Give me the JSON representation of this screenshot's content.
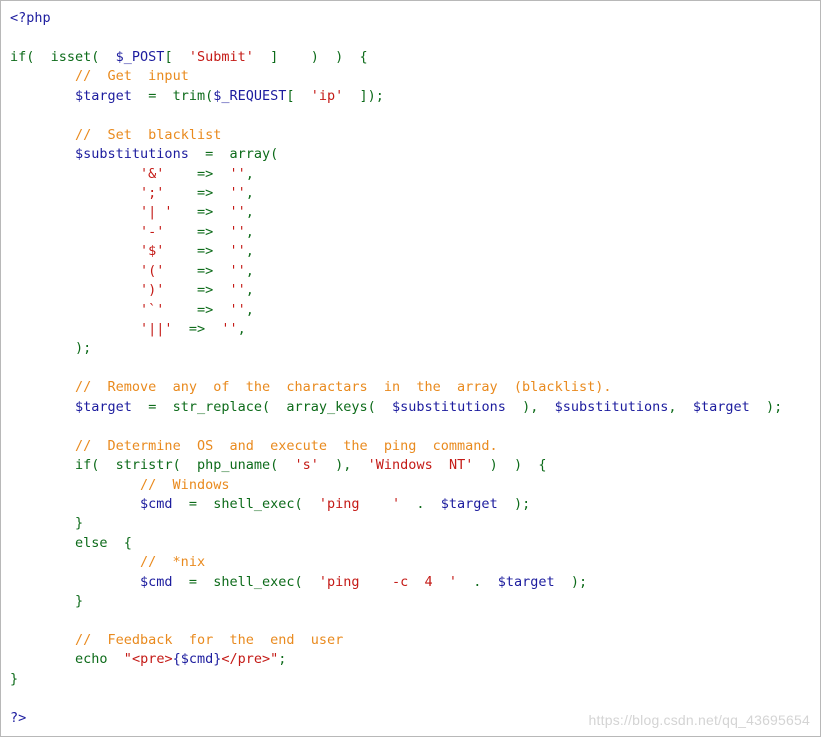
{
  "colors": {
    "keyword": "#0d6b1a",
    "variable": "#1c1c9e",
    "string": "#c41a16",
    "comment": "#e98a1e",
    "background": "#ffffff",
    "watermark": "#d4d4d4"
  },
  "code_lines": [
    [
      {
        "t": "<?php",
        "c": "tag"
      }
    ],
    [],
    [
      {
        "t": "if(  ",
        "c": "kw"
      },
      {
        "t": "isset(  ",
        "c": "fn"
      },
      {
        "t": "$_POST",
        "c": "var"
      },
      {
        "t": "[  ",
        "c": "pn"
      },
      {
        "t": "'Submit'",
        "c": "str"
      },
      {
        "t": "  ]    )  )  {",
        "c": "pn"
      }
    ],
    [
      {
        "t": "        ",
        "c": "pn"
      },
      {
        "t": "//  Get  input",
        "c": "com"
      }
    ],
    [
      {
        "t": "        ",
        "c": "pn"
      },
      {
        "t": "$target",
        "c": "var"
      },
      {
        "t": "  =  ",
        "c": "pn"
      },
      {
        "t": "trim(",
        "c": "fn"
      },
      {
        "t": "$_REQUEST",
        "c": "var"
      },
      {
        "t": "[  ",
        "c": "pn"
      },
      {
        "t": "'ip'",
        "c": "str"
      },
      {
        "t": "  ]);",
        "c": "pn"
      }
    ],
    [],
    [
      {
        "t": "        ",
        "c": "pn"
      },
      {
        "t": "//  Set  blacklist",
        "c": "com"
      }
    ],
    [
      {
        "t": "        ",
        "c": "pn"
      },
      {
        "t": "$substitutions",
        "c": "var"
      },
      {
        "t": "  =  ",
        "c": "pn"
      },
      {
        "t": "array(",
        "c": "fn"
      }
    ],
    [
      {
        "t": "                ",
        "c": "pn"
      },
      {
        "t": "'&'",
        "c": "str"
      },
      {
        "t": "    =>  ",
        "c": "pn"
      },
      {
        "t": "''",
        "c": "str"
      },
      {
        "t": ",",
        "c": "pn"
      }
    ],
    [
      {
        "t": "                ",
        "c": "pn"
      },
      {
        "t": "';'",
        "c": "str"
      },
      {
        "t": "    =>  ",
        "c": "pn"
      },
      {
        "t": "''",
        "c": "str"
      },
      {
        "t": ",",
        "c": "pn"
      }
    ],
    [
      {
        "t": "                ",
        "c": "pn"
      },
      {
        "t": "'| '",
        "c": "str"
      },
      {
        "t": "   =>  ",
        "c": "pn"
      },
      {
        "t": "''",
        "c": "str"
      },
      {
        "t": ",",
        "c": "pn"
      }
    ],
    [
      {
        "t": "                ",
        "c": "pn"
      },
      {
        "t": "'-'",
        "c": "str"
      },
      {
        "t": "    =>  ",
        "c": "pn"
      },
      {
        "t": "''",
        "c": "str"
      },
      {
        "t": ",",
        "c": "pn"
      }
    ],
    [
      {
        "t": "                ",
        "c": "pn"
      },
      {
        "t": "'$'",
        "c": "str"
      },
      {
        "t": "    =>  ",
        "c": "pn"
      },
      {
        "t": "''",
        "c": "str"
      },
      {
        "t": ",",
        "c": "pn"
      }
    ],
    [
      {
        "t": "                ",
        "c": "pn"
      },
      {
        "t": "'('",
        "c": "str"
      },
      {
        "t": "    =>  ",
        "c": "pn"
      },
      {
        "t": "''",
        "c": "str"
      },
      {
        "t": ",",
        "c": "pn"
      }
    ],
    [
      {
        "t": "                ",
        "c": "pn"
      },
      {
        "t": "')'",
        "c": "str"
      },
      {
        "t": "    =>  ",
        "c": "pn"
      },
      {
        "t": "''",
        "c": "str"
      },
      {
        "t": ",",
        "c": "pn"
      }
    ],
    [
      {
        "t": "                ",
        "c": "pn"
      },
      {
        "t": "'`'",
        "c": "str"
      },
      {
        "t": "    =>  ",
        "c": "pn"
      },
      {
        "t": "''",
        "c": "str"
      },
      {
        "t": ",",
        "c": "pn"
      }
    ],
    [
      {
        "t": "                ",
        "c": "pn"
      },
      {
        "t": "'||'",
        "c": "str"
      },
      {
        "t": "  =>  ",
        "c": "pn"
      },
      {
        "t": "''",
        "c": "str"
      },
      {
        "t": ",",
        "c": "pn"
      }
    ],
    [
      {
        "t": "        );",
        "c": "pn"
      }
    ],
    [],
    [
      {
        "t": "        ",
        "c": "pn"
      },
      {
        "t": "//  Remove  any  of  the  charactars  in  the  array  (blacklist).",
        "c": "com"
      }
    ],
    [
      {
        "t": "        ",
        "c": "pn"
      },
      {
        "t": "$target",
        "c": "var"
      },
      {
        "t": "  =  ",
        "c": "pn"
      },
      {
        "t": "str_replace(  ",
        "c": "fn"
      },
      {
        "t": "array_keys(  ",
        "c": "fn"
      },
      {
        "t": "$substitutions",
        "c": "var"
      },
      {
        "t": "  ),  ",
        "c": "pn"
      },
      {
        "t": "$substitutions",
        "c": "var"
      },
      {
        "t": ",  ",
        "c": "pn"
      },
      {
        "t": "$target",
        "c": "var"
      },
      {
        "t": "  );",
        "c": "pn"
      }
    ],
    [],
    [
      {
        "t": "        ",
        "c": "pn"
      },
      {
        "t": "//  Determine  OS  and  execute  the  ping  command.",
        "c": "com"
      }
    ],
    [
      {
        "t": "        if(  ",
        "c": "kw"
      },
      {
        "t": "stristr(  ",
        "c": "fn"
      },
      {
        "t": "php_uname(  ",
        "c": "fn"
      },
      {
        "t": "'s'",
        "c": "str"
      },
      {
        "t": "  ),  ",
        "c": "pn"
      },
      {
        "t": "'Windows  NT'",
        "c": "str"
      },
      {
        "t": "  )  )  {",
        "c": "pn"
      }
    ],
    [
      {
        "t": "                ",
        "c": "pn"
      },
      {
        "t": "//  Windows",
        "c": "com"
      }
    ],
    [
      {
        "t": "                ",
        "c": "pn"
      },
      {
        "t": "$cmd",
        "c": "var"
      },
      {
        "t": "  =  ",
        "c": "pn"
      },
      {
        "t": "shell_exec(  ",
        "c": "fn"
      },
      {
        "t": "'ping    '",
        "c": "str"
      },
      {
        "t": "  .  ",
        "c": "pn"
      },
      {
        "t": "$target",
        "c": "var"
      },
      {
        "t": "  );",
        "c": "pn"
      }
    ],
    [
      {
        "t": "        }",
        "c": "pn"
      }
    ],
    [
      {
        "t": "        else  {",
        "c": "kw"
      }
    ],
    [
      {
        "t": "                ",
        "c": "pn"
      },
      {
        "t": "//  *nix",
        "c": "com"
      }
    ],
    [
      {
        "t": "                ",
        "c": "pn"
      },
      {
        "t": "$cmd",
        "c": "var"
      },
      {
        "t": "  =  ",
        "c": "pn"
      },
      {
        "t": "shell_exec(  ",
        "c": "fn"
      },
      {
        "t": "'ping    -c  4  '",
        "c": "str"
      },
      {
        "t": "  .  ",
        "c": "pn"
      },
      {
        "t": "$target",
        "c": "var"
      },
      {
        "t": "  );",
        "c": "pn"
      }
    ],
    [
      {
        "t": "        }",
        "c": "pn"
      }
    ],
    [],
    [
      {
        "t": "        ",
        "c": "pn"
      },
      {
        "t": "//  Feedback  for  the  end  user",
        "c": "com"
      }
    ],
    [
      {
        "t": "        echo  ",
        "c": "kw"
      },
      {
        "t": "\"",
        "c": "str"
      },
      {
        "t": "<pre>",
        "c": "str"
      },
      {
        "t": "{$cmd}",
        "c": "var"
      },
      {
        "t": "</pre>",
        "c": "str"
      },
      {
        "t": "\"",
        "c": "str"
      },
      {
        "t": ";",
        "c": "pn"
      }
    ],
    [
      {
        "t": "}",
        "c": "pn"
      }
    ],
    [],
    [
      {
        "t": "?>",
        "c": "tag"
      }
    ]
  ],
  "watermark": "https://blog.csdn.net/qq_43695654"
}
